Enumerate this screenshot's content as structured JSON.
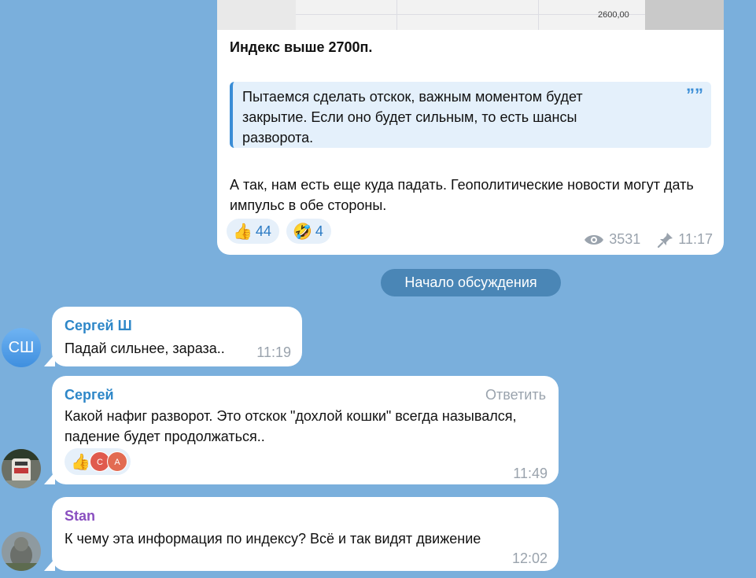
{
  "post": {
    "chart_tick": "2600,00",
    "title": "Индекс выше 2700п.",
    "quote": "Пытаемся сделать отскок, важным моментом будет закрытие. Если оно будет сильным, то есть шансы разворота.",
    "quote_icon": "””",
    "body": "А так, нам есть еще куда падать. Геополитические новости могут дать импульс в обе стороны.",
    "reactions": [
      {
        "emoji": "👍",
        "count": "44"
      },
      {
        "emoji": "🤣",
        "count": "4"
      }
    ],
    "views": "3531",
    "time": "11:17"
  },
  "divider": "Начало обсуждения",
  "messages": [
    {
      "author": "Сергей Ш",
      "author_color": "#2e87c8",
      "avatar_initials": "СШ",
      "text": "Падай сильнее, зараза..",
      "time": "11:19"
    },
    {
      "author": "Сергей",
      "author_color": "#2e87c8",
      "reply_label": "Ответить",
      "text": "Какой нафиг разворот. Это отскок \"дохлой кошки\" всегда назывался, падение будет продолжаться..",
      "reaction_emoji": "👍",
      "reactors": [
        "С",
        "А"
      ],
      "time": "11:49"
    },
    {
      "author": "Stan",
      "author_color": "#8a4fc0",
      "text": "К чему эта информация по индексу? Всё и так видят движение",
      "time": "12:02"
    }
  ]
}
